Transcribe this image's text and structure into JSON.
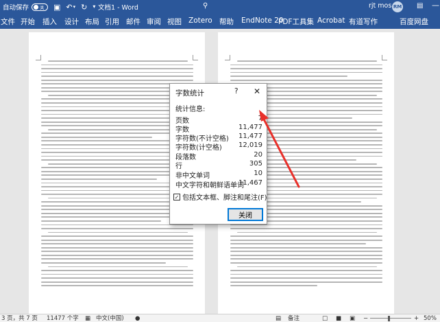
{
  "titlebar": {
    "autosave_label": "自动保存",
    "autosave_state": "关",
    "doc_title": "文档1 - Word",
    "user_name": "rjt mos",
    "avatar_initials": "RM"
  },
  "menu": [
    "文件",
    "开始",
    "插入",
    "设计",
    "布局",
    "引用",
    "邮件",
    "审阅",
    "视图",
    "Zotero",
    "帮助",
    "EndNote 20",
    "PDF工具集",
    "Acrobat",
    "有道写作",
    "百度网盘"
  ],
  "dialog": {
    "title": "字数统计",
    "help": "?",
    "stats_header": "统计信息:",
    "stats": [
      {
        "label": "页数",
        "value": "7"
      },
      {
        "label": "字数",
        "value": "11,477"
      },
      {
        "label": "字符数(不计空格)",
        "value": "11,477"
      },
      {
        "label": "字符数(计空格)",
        "value": "12,019"
      },
      {
        "label": "段落数",
        "value": "20"
      },
      {
        "label": "行",
        "value": "305"
      },
      {
        "label": "非中文单词",
        "value": "10"
      },
      {
        "label": "中文字符和朝鲜语单词",
        "value": "11,467"
      }
    ],
    "checkbox_label": "包括文本框、脚注和尾注(F)",
    "checkbox_checked": true,
    "close_label": "关闭"
  },
  "statusbar": {
    "page_info": "3 页，共 7 页",
    "word_count": "11477 个字",
    "language": "中文(中国)",
    "notes_label": "备注",
    "zoom": "50%"
  },
  "colors": {
    "accent": "#2b579a",
    "annotation": "#e8302a"
  }
}
